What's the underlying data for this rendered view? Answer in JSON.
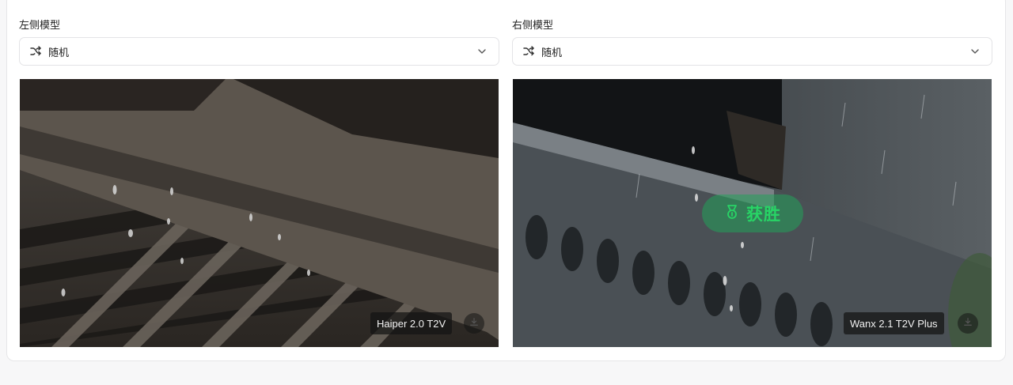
{
  "left": {
    "label": "左侧模型",
    "select_value": "随机",
    "model_name": "Haiper 2.0 T2V"
  },
  "right": {
    "label": "右侧模型",
    "select_value": "随机",
    "model_name": "Wanx 2.1 T2V Plus",
    "winner_text": "获胜"
  },
  "icons": {
    "select_prefix": "shuffle-icon",
    "select_suffix": "chevron-down-icon",
    "media_action": "download-icon",
    "winner": "medal-icon"
  },
  "colors": {
    "winner_bg": "#22a05a",
    "winner_text": "#28d466",
    "card_bg": "#ffffff",
    "page_bg": "#f7f7f8"
  }
}
